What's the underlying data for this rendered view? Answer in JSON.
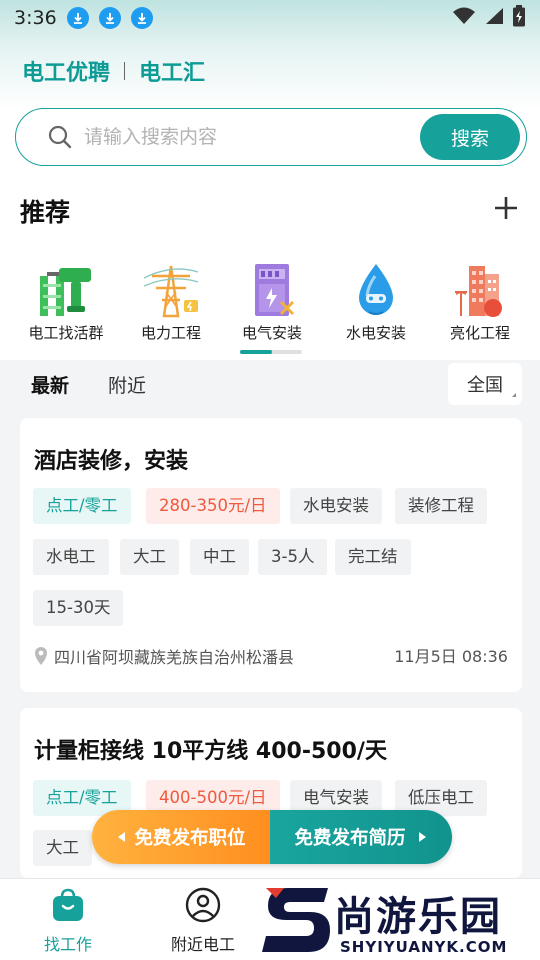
{
  "status_bar": {
    "time": "3:36"
  },
  "brand": {
    "primary": "电工优聘",
    "secondary": "电工汇"
  },
  "search": {
    "placeholder": "请输入搜索内容",
    "button": "搜索"
  },
  "recommend": {
    "title": "推荐",
    "categories": [
      {
        "label": "电工找活群",
        "icon": "drill-ladder-icon"
      },
      {
        "label": "电力工程",
        "icon": "power-tower-icon"
      },
      {
        "label": "电气安装",
        "icon": "electric-cabinet-icon",
        "active": true
      },
      {
        "label": "水电安装",
        "icon": "water-drop-icon"
      },
      {
        "label": "亮化工程",
        "icon": "city-building-icon"
      }
    ]
  },
  "filter": {
    "tabs": [
      "最新",
      "附近"
    ],
    "active_tab": "最新",
    "region": "全国"
  },
  "jobs": [
    {
      "title": "酒店装修，安装",
      "tags": [
        "点工/零工",
        "280-350元/日",
        "水电安装",
        "装修工程",
        "水电工",
        "大工",
        "中工",
        "3-5人",
        "完工结",
        "15-30天"
      ],
      "location": "四川省阿坝藏族羌族自治州松潘县",
      "time": "11月5日 08:36"
    },
    {
      "title": "计量柜接线 10平方线 400-500/天",
      "tags": [
        "点工/零工",
        "400-500元/日",
        "电气安装",
        "低压电工",
        "大工"
      ]
    }
  ],
  "publish": {
    "job": "免费发布职位",
    "resume": "免费发布简历"
  },
  "bottom_nav": {
    "items": [
      "找工作",
      "附近电工"
    ]
  },
  "watermark": {
    "text": "尚游乐园",
    "sub": "SHYIYUANYK.COM"
  },
  "colors": {
    "accent": "#17a19b",
    "orange": "#ff9a2a",
    "price": "#ef5a3e"
  }
}
